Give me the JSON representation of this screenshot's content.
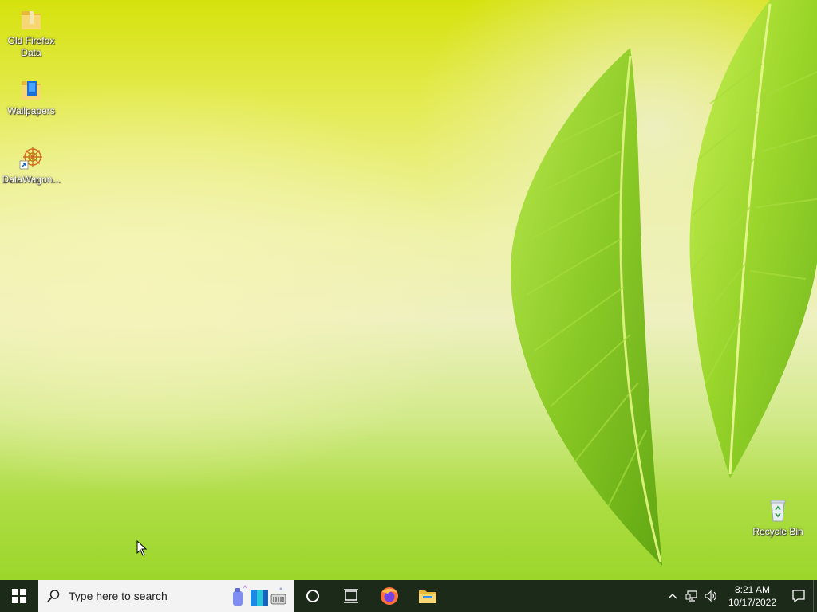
{
  "desktop": {
    "icons": [
      {
        "label": "Old Firefox Data",
        "icon": "folder-icon"
      },
      {
        "label": "Wallpapers",
        "icon": "folder-icon"
      },
      {
        "label": "DataWagon...",
        "icon": "datawagon-shortcut-icon"
      }
    ],
    "recycle_bin": {
      "label": "Recycle Bin",
      "icon": "recycle-bin-icon"
    }
  },
  "taskbar": {
    "search": {
      "placeholder": "Type here to search"
    },
    "apps": [
      {
        "name": "Cortana",
        "icon": "cortana-circle-icon"
      },
      {
        "name": "Task View",
        "icon": "task-view-icon"
      },
      {
        "name": "Firefox",
        "icon": "firefox-icon"
      },
      {
        "name": "File Explorer",
        "icon": "file-explorer-icon"
      }
    ],
    "clock": {
      "time": "8:21 AM",
      "date": "10/17/2022"
    }
  },
  "colors": {
    "taskbar_bg": "#1c2a1a",
    "search_bg": "#f3f3f3",
    "leaf_green": "#8fd02a",
    "folder_yellow": "#f2c94c",
    "firefox_orange": "#ff7139"
  }
}
